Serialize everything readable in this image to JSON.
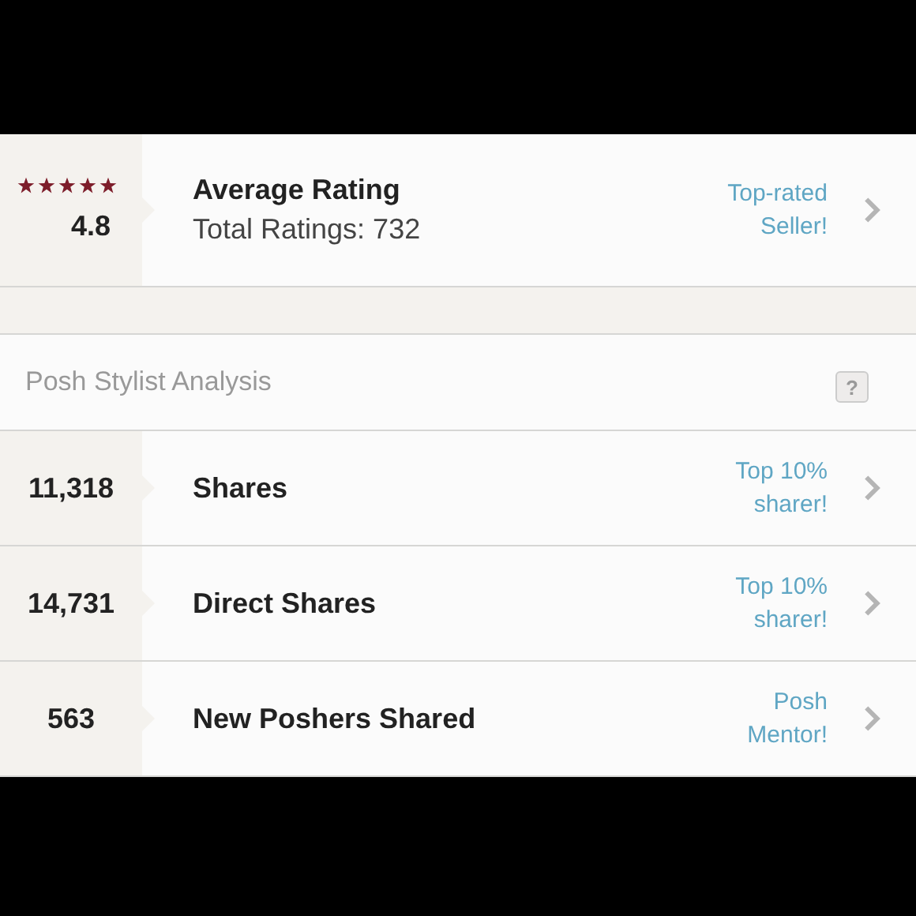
{
  "rating": {
    "stars": 5,
    "value": "4.8",
    "title": "Average Rating",
    "subtitle": "Total Ratings: 732",
    "badge": [
      "Top-rated",
      "Seller!"
    ]
  },
  "analysis": {
    "title": "Posh Stylist Analysis",
    "help": "?"
  },
  "stats": [
    {
      "value": "11,318",
      "label": "Shares",
      "badge": [
        "Top 10%",
        "sharer!"
      ]
    },
    {
      "value": "14,731",
      "label": "Direct Shares",
      "badge": [
        "Top 10%",
        "sharer!"
      ]
    },
    {
      "value": "563",
      "label": "New Poshers Shared",
      "badge": [
        "Posh",
        "Mentor!"
      ]
    }
  ]
}
